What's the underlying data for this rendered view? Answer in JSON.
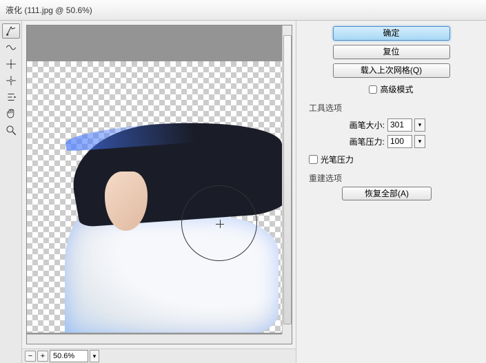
{
  "titlebar": {
    "text": "液化 (111.jpg @ 50.6%)"
  },
  "tools": {
    "forward_warp": "forward-warp-tool",
    "reconstruct": "reconstruct-tool",
    "pucker": "pucker-tool",
    "bloat": "bloat-tool",
    "push_left": "push-left-tool",
    "hand": "hand-tool",
    "zoom": "zoom-tool"
  },
  "buttons": {
    "ok": "确定",
    "reset": "复位",
    "load_mesh": "载入上次网格(Q)",
    "advanced_mode": "高级模式",
    "restore_all": "恢复全部(A)"
  },
  "sections": {
    "tool_options": "工具选项",
    "reconstruct_options": "重建选项"
  },
  "brush": {
    "size_label": "画笔大小:",
    "size_value": "301",
    "pressure_label": "画笔压力:",
    "pressure_value": "100",
    "pen_pressure": "光笔压力"
  },
  "zoom": {
    "value": "50.6%",
    "minus": "−",
    "plus": "+"
  },
  "advanced_checked": false,
  "pen_pressure_checked": false
}
